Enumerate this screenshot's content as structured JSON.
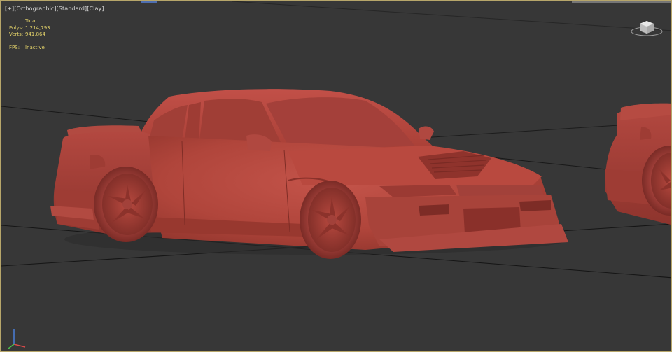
{
  "viewport": {
    "labels": {
      "plus": "[+]",
      "view": "[Orthographic]",
      "shading": "[Standard]",
      "style": "[Clay]"
    },
    "stats": {
      "header": "Total",
      "polys_label": "Polys:",
      "polys_value": "1,214,793",
      "verts_label": "Verts:",
      "verts_value": "941,864",
      "fps_label": "FPS:",
      "fps_value": "Inactive"
    },
    "colors": {
      "viewport_border": "#b7a66a",
      "background": "#373737",
      "stats_text": "#e4d36a",
      "clay_model": "#b5473c",
      "grid_line": "#151515"
    },
    "icons": {
      "viewcube": "viewcube-icon",
      "axis": "axis-tripod-icon"
    }
  }
}
